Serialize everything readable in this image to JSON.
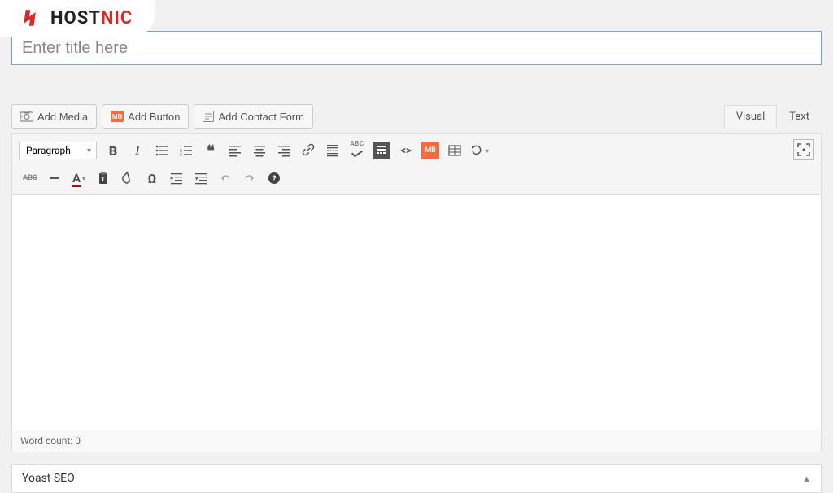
{
  "brand": {
    "name1": "HOST",
    "name2": "NIC"
  },
  "title": {
    "placeholder": "Enter title here",
    "value": ""
  },
  "buttons": {
    "add_media": "Add Media",
    "add_button": "Add Button",
    "add_contact": "Add Contact Form"
  },
  "tabs": {
    "visual": "Visual",
    "text": "Text"
  },
  "format": {
    "current": "Paragraph"
  },
  "toolbar": {
    "abc_check": "ABC",
    "mb_label": "MB"
  },
  "footer": {
    "word_count_label": "Word count: ",
    "word_count_value": "0"
  },
  "yoast": {
    "title": "Yoast SEO"
  }
}
